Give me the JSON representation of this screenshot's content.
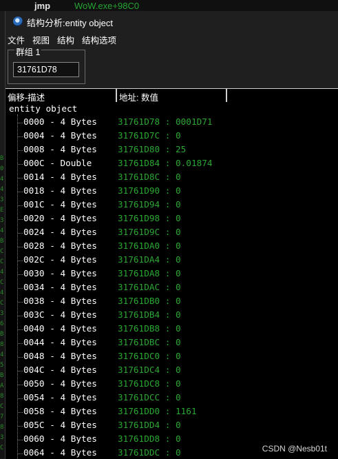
{
  "background": {
    "opcode": "jmp",
    "operand": "WoW.exe+98C0",
    "left_chars": [
      "B",
      "0",
      "4",
      "4",
      "3",
      "E",
      "3",
      "4",
      "B",
      "C",
      "C",
      "4",
      "C",
      "4",
      "C",
      "3",
      "6",
      "B",
      "8",
      "4",
      "5",
      "B",
      "A",
      "8",
      "C",
      "7",
      "8",
      "3",
      "C"
    ]
  },
  "window": {
    "title": "结构分析:entity object",
    "icon": "app-globe-icon"
  },
  "menu": [
    "文件",
    "视图",
    "结构",
    "结构选项"
  ],
  "group": {
    "label": "群组 1",
    "address_value": "31761D78"
  },
  "columns": [
    "偏移-描述",
    "地址: 数值",
    ""
  ],
  "tree": {
    "root_label": "entity object",
    "rows": [
      {
        "desc": "0000 - 4 Bytes",
        "addr": "31761D78 : 0001D71"
      },
      {
        "desc": "0004 - 4 Bytes",
        "addr": "31761D7C : 0"
      },
      {
        "desc": "0008 - 4 Bytes",
        "addr": "31761D80 : 25"
      },
      {
        "desc": "000C - Double ",
        "addr": "31761D84 : 0.01874"
      },
      {
        "desc": "0014 - 4 Bytes",
        "addr": "31761D8C : 0"
      },
      {
        "desc": "0018 - 4 Bytes",
        "addr": "31761D90 : 0"
      },
      {
        "desc": "001C - 4 Bytes",
        "addr": "31761D94 : 0"
      },
      {
        "desc": "0020 - 4 Bytes",
        "addr": "31761D98 : 0"
      },
      {
        "desc": "0024 - 4 Bytes",
        "addr": "31761D9C : 0"
      },
      {
        "desc": "0028 - 4 Bytes",
        "addr": "31761DA0 : 0"
      },
      {
        "desc": "002C - 4 Bytes",
        "addr": "31761DA4 : 0"
      },
      {
        "desc": "0030 - 4 Bytes",
        "addr": "31761DA8 : 0"
      },
      {
        "desc": "0034 - 4 Bytes",
        "addr": "31761DAC : 0"
      },
      {
        "desc": "0038 - 4 Bytes",
        "addr": "31761DB0 : 0"
      },
      {
        "desc": "003C - 4 Bytes",
        "addr": "31761DB4 : 0"
      },
      {
        "desc": "0040 - 4 Bytes",
        "addr": "31761DB8 : 0"
      },
      {
        "desc": "0044 - 4 Bytes",
        "addr": "31761DBC : 0"
      },
      {
        "desc": "0048 - 4 Bytes",
        "addr": "31761DC0 : 0"
      },
      {
        "desc": "004C - 4 Bytes",
        "addr": "31761DC4 : 0"
      },
      {
        "desc": "0050 - 4 Bytes",
        "addr": "31761DC8 : 0"
      },
      {
        "desc": "0054 - 4 Bytes",
        "addr": "31761DCC : 0"
      },
      {
        "desc": "0058 - 4 Bytes",
        "addr": "31761DD0 : 1161"
      },
      {
        "desc": "005C - 4 Bytes",
        "addr": "31761DD4 : 0"
      },
      {
        "desc": "0060 - 4 Bytes",
        "addr": "31761DD8 : 0"
      },
      {
        "desc": "0064 - 4 Bytes",
        "addr": "31761DDC : 0"
      }
    ]
  },
  "watermark": "CSDN @Nesb01t",
  "colors": {
    "address_green": "#2aa832",
    "background": "#000000",
    "window": "#1f1f1f"
  }
}
